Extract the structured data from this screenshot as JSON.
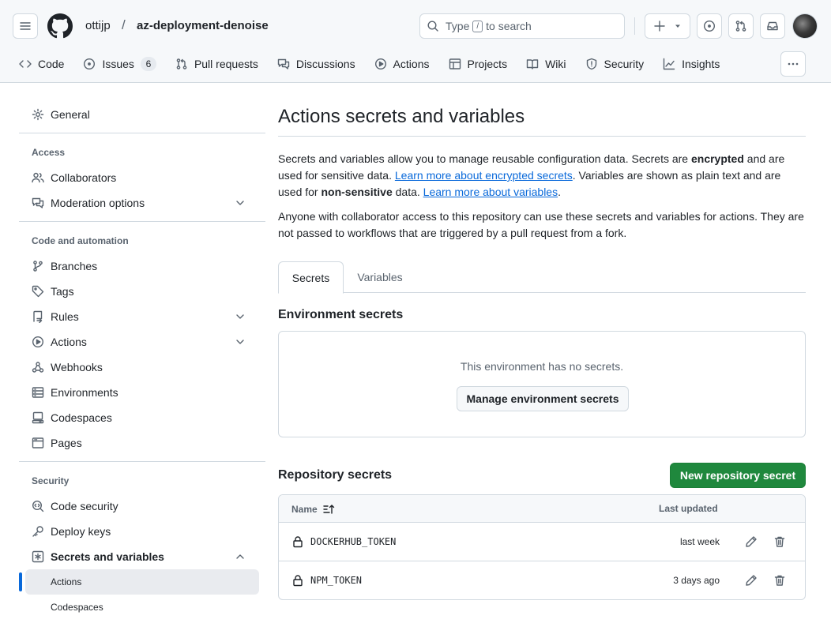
{
  "header": {
    "owner": "ottijp",
    "separator": "/",
    "repo": "az-deployment-denoise",
    "search_prefix": "Type",
    "search_key": "/",
    "search_suffix": "to search"
  },
  "nav": {
    "items": [
      {
        "label": "Code",
        "icon": "code-icon"
      },
      {
        "label": "Issues",
        "icon": "issue-icon",
        "count": "6"
      },
      {
        "label": "Pull requests",
        "icon": "pull-request-icon"
      },
      {
        "label": "Discussions",
        "icon": "discussion-icon"
      },
      {
        "label": "Actions",
        "icon": "play-icon"
      },
      {
        "label": "Projects",
        "icon": "table-icon"
      },
      {
        "label": "Wiki",
        "icon": "book-icon"
      },
      {
        "label": "Security",
        "icon": "shield-icon"
      },
      {
        "label": "Insights",
        "icon": "graph-icon"
      }
    ]
  },
  "sidebar": {
    "general": "General",
    "access_heading": "Access",
    "collaborators": "Collaborators",
    "moderation": "Moderation options",
    "code_heading": "Code and automation",
    "branches": "Branches",
    "tags": "Tags",
    "rules": "Rules",
    "actions": "Actions",
    "webhooks": "Webhooks",
    "environments": "Environments",
    "codespaces": "Codespaces",
    "pages": "Pages",
    "security_heading": "Security",
    "code_security": "Code security",
    "deploy_keys": "Deploy keys",
    "secrets_variables": "Secrets and variables",
    "sub_actions": "Actions",
    "sub_codespaces": "Codespaces"
  },
  "main": {
    "title": "Actions secrets and variables",
    "p1_a": "Secrets and variables allow you to manage reusable configuration data. Secrets are ",
    "p1_bold1": "encrypted",
    "p1_b": " and are used for sensitive data. ",
    "p1_link1": "Learn more about encrypted secrets",
    "p1_c": ". Variables are shown as plain text and are used for ",
    "p1_bold2": "non-sensitive",
    "p1_d": " data. ",
    "p1_link2": "Learn more about variables",
    "p1_e": ".",
    "p2": "Anyone with collaborator access to this repository can use these secrets and variables for actions. They are not passed to workflows that are triggered by a pull request from a fork.",
    "tab_secrets": "Secrets",
    "tab_variables": "Variables",
    "env_title": "Environment secrets",
    "env_empty": "This environment has no secrets.",
    "env_button": "Manage environment secrets",
    "repo_title": "Repository secrets",
    "new_button": "New repository secret",
    "col_name": "Name",
    "col_updated": "Last updated",
    "rows": [
      {
        "name": "DOCKERHUB_TOKEN",
        "updated": "last week"
      },
      {
        "name": "NPM_TOKEN",
        "updated": "3 days ago"
      }
    ]
  },
  "colors": {
    "accent": "#0969da",
    "primary_button": "#1f883d",
    "border": "#d1d9e0",
    "muted_text": "#59636e"
  }
}
